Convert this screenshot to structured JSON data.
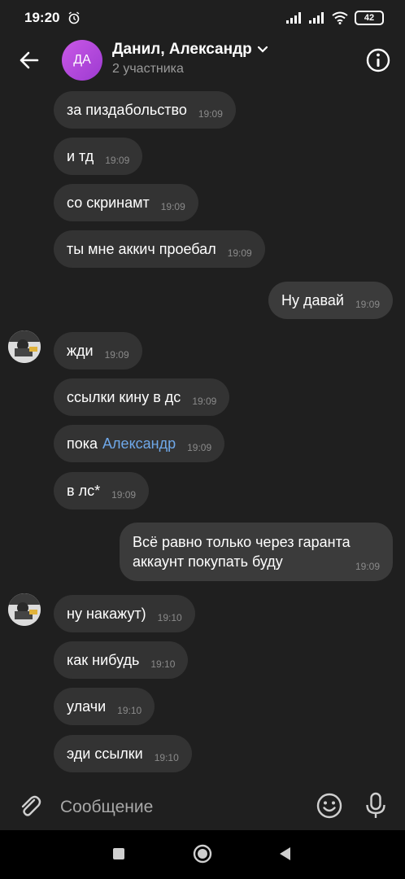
{
  "status_bar": {
    "time": "19:20",
    "battery": "42"
  },
  "header": {
    "avatar_initials": "ДА",
    "title": "Данил, Александр",
    "subtitle": "2 участника"
  },
  "messages": [
    {
      "text": "за пиздабольство",
      "time": "19:09",
      "direction": "in"
    },
    {
      "text": "и тд",
      "time": "19:09",
      "direction": "in"
    },
    {
      "text": "со скринамт",
      "time": "19:09",
      "direction": "in"
    },
    {
      "text": "ты мне аккич проебал",
      "time": "19:09",
      "direction": "in"
    },
    {
      "text": "Ну давай",
      "time": "19:09",
      "direction": "out"
    },
    {
      "text": "жди",
      "time": "19:09",
      "direction": "in"
    },
    {
      "text": "ссылки кину в дс",
      "time": "19:09",
      "direction": "in"
    },
    {
      "text": "пока",
      "mention": "Александр",
      "time": "19:09",
      "direction": "in"
    },
    {
      "text": "в лс*",
      "time": "19:09",
      "direction": "in"
    },
    {
      "line1": "Всё равно только через гаранта",
      "line2": "аккаунт покупать буду",
      "time": "19:09",
      "direction": "out"
    },
    {
      "text": "ну накажут)",
      "time": "19:10",
      "direction": "in"
    },
    {
      "text": "как нибудь",
      "time": "19:10",
      "direction": "in"
    },
    {
      "text": "улачи",
      "time": "19:10",
      "direction": "in"
    },
    {
      "text": "эди ссылки",
      "time": "19:10",
      "direction": "in"
    }
  ],
  "composer": {
    "placeholder": "Сообщение"
  },
  "icons": {
    "back": "arrow-left-icon",
    "info": "info-icon",
    "attach": "paperclip-icon",
    "emoji": "smiley-icon",
    "mic": "microphone-icon"
  }
}
